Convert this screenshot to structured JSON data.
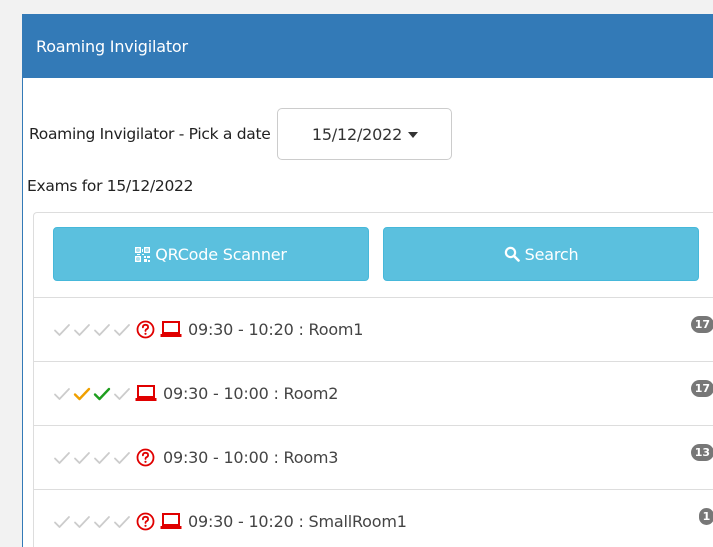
{
  "panel": {
    "title": "Roaming Invigilator"
  },
  "date_picker": {
    "label": "Roaming Invigilator - Pick a date",
    "value": "15/12/2022"
  },
  "exams_heading": "Exams for 15/12/2022",
  "buttons": {
    "qr_label": "QRCode Scanner",
    "search_label": "Search"
  },
  "colors": {
    "primary": "#337ab7",
    "info": "#5bc0de",
    "tick_grey": "#cccccc",
    "tick_orange": "#f0a000",
    "tick_green": "#1e9e1e",
    "alert_red": "#e00000",
    "badge_grey": "#777777"
  },
  "exams": [
    {
      "time": "09:30 - 10:20",
      "room": "Room1",
      "text": "09:30 - 10:20 : Room1",
      "ticks": [
        "grey",
        "grey",
        "grey",
        "grey"
      ],
      "question_icon": true,
      "computer_icon": true,
      "count": "17"
    },
    {
      "time": "09:30 - 10:00",
      "room": "Room2",
      "text": "09:30 - 10:00 : Room2",
      "ticks": [
        "grey",
        "orange",
        "green",
        "grey"
      ],
      "question_icon": false,
      "computer_icon": true,
      "count": "17"
    },
    {
      "time": "09:30 - 10:00",
      "room": "Room3",
      "text": "09:30 - 10:00 : Room3",
      "ticks": [
        "grey",
        "grey",
        "grey",
        "grey"
      ],
      "question_icon": true,
      "computer_icon": false,
      "count": "13"
    },
    {
      "time": "09:30 - 10:20",
      "room": "SmallRoom1",
      "text": "09:30 - 10:20 : SmallRoom1",
      "ticks": [
        "grey",
        "grey",
        "grey",
        "grey"
      ],
      "question_icon": true,
      "computer_icon": true,
      "count": "1"
    }
  ]
}
